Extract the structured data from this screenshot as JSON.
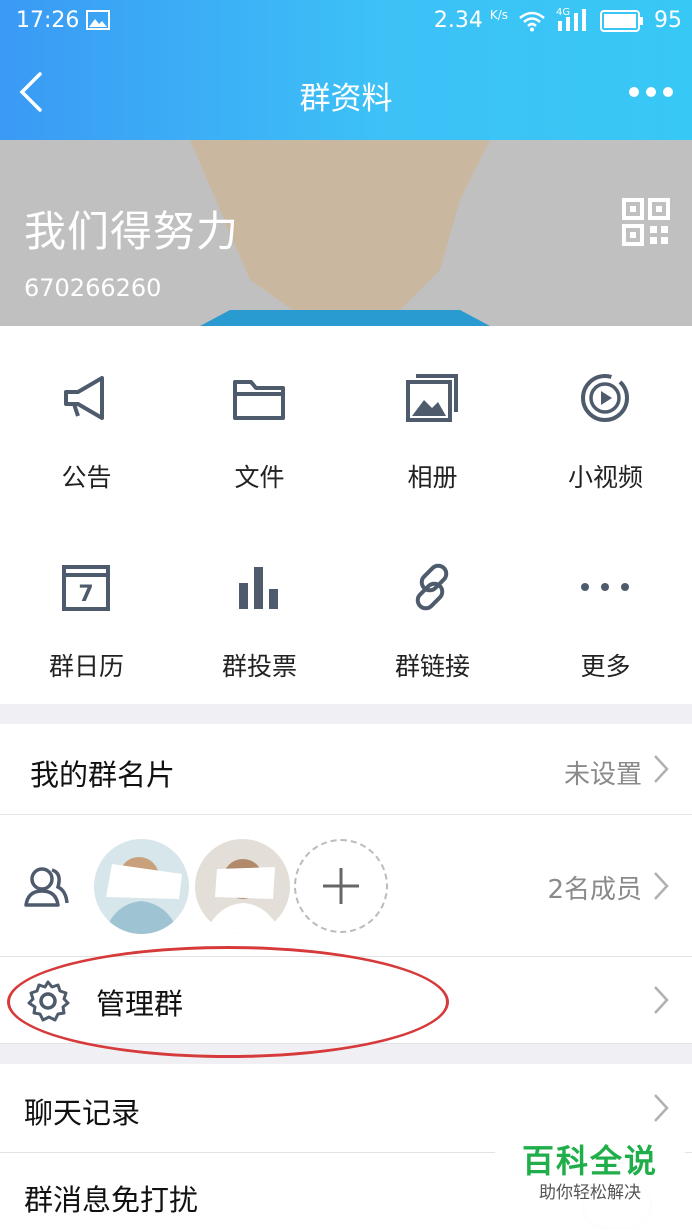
{
  "status_bar": {
    "time": "17:26",
    "speed": "2.34",
    "speed_unit": "K/s",
    "network": "4G",
    "battery": "95"
  },
  "titlebar": {
    "title": "群资料",
    "back_icon": "chevron-left-icon",
    "more_icon": "more-dots-icon"
  },
  "group": {
    "name": "我们得努力",
    "id": "670266260",
    "qr_icon": "qr-code-icon"
  },
  "functions": [
    {
      "label": "公告",
      "icon": "megaphone-icon"
    },
    {
      "label": "文件",
      "icon": "folder-icon"
    },
    {
      "label": "相册",
      "icon": "photo-album-icon"
    },
    {
      "label": "小视频",
      "icon": "video-play-icon"
    },
    {
      "label": "群日历",
      "icon": "calendar-icon",
      "icon_text": "7"
    },
    {
      "label": "群投票",
      "icon": "bar-chart-icon"
    },
    {
      "label": "群链接",
      "icon": "link-icon"
    },
    {
      "label": "更多",
      "icon": "more-dots-icon"
    }
  ],
  "card_row": {
    "label": "我的群名片",
    "value": "未设置"
  },
  "members_row": {
    "count_text": "2名成员",
    "add_symbol": "+"
  },
  "manage_row": {
    "label": "管理群"
  },
  "chat_row": {
    "label": "聊天记录"
  },
  "mute_row": {
    "label": "群消息免打扰"
  },
  "watermark": {
    "title": "百科全说",
    "subtitle": "助你轻松解决"
  },
  "colors": {
    "accent": "#3dc1f6",
    "icon": "#4e5b6c",
    "highlight": "#d63a3a",
    "watermark": "#1fae4a"
  }
}
